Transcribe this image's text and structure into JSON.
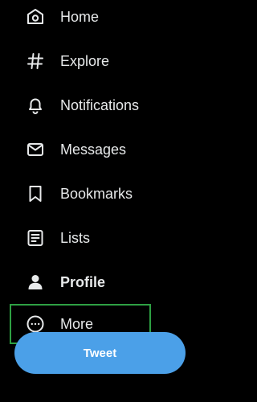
{
  "nav": {
    "items": [
      {
        "label": "Home",
        "icon": "home-icon"
      },
      {
        "label": "Explore",
        "icon": "hashtag-icon"
      },
      {
        "label": "Notifications",
        "icon": "bell-icon"
      },
      {
        "label": "Messages",
        "icon": "envelope-icon"
      },
      {
        "label": "Bookmarks",
        "icon": "bookmark-icon"
      },
      {
        "label": "Lists",
        "icon": "list-icon"
      },
      {
        "label": "Profile",
        "icon": "person-icon"
      },
      {
        "label": "More",
        "icon": "more-circle-icon"
      }
    ]
  },
  "tweet_button": {
    "label": "Tweet"
  },
  "colors": {
    "background": "#000000",
    "text": "#e7e9ea",
    "accent": "#4ba0e8",
    "highlight_border": "#2ea043"
  }
}
